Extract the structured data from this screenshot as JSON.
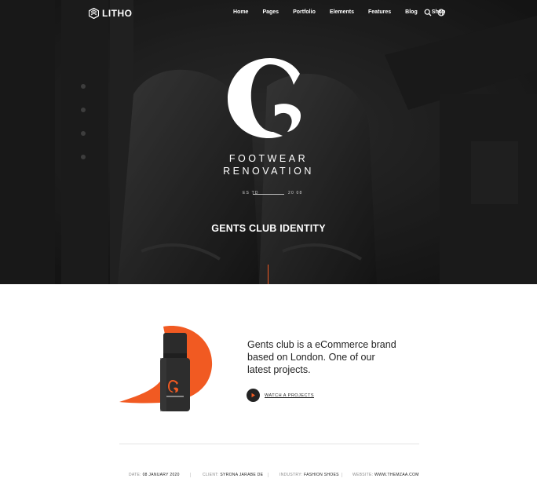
{
  "nav": {
    "logo_text": "LITHO",
    "items": [
      {
        "label": "Home"
      },
      {
        "label": "Pages"
      },
      {
        "label": "Portfolio"
      },
      {
        "label": "Elements"
      },
      {
        "label": "Features"
      },
      {
        "label": "Blog"
      },
      {
        "label": "Shop"
      }
    ],
    "icons": [
      "search-icon",
      "globe-icon"
    ]
  },
  "hero": {
    "brand_line1": "FOOTWEAR",
    "brand_line2": "RENOVATION",
    "estd_left": "ES TD",
    "estd_right": "20 08",
    "title": "GENTS CLUB IDENTITY"
  },
  "intro": {
    "text": "Gents club is a eCommerce brand based on London. One of our latest projects.",
    "watch_label": "WATCH A PROJECTS"
  },
  "meta": [
    {
      "label": "DATE:",
      "value": "08 JANUARY 2020"
    },
    {
      "label": "CLIENT:",
      "value": "SYRONA JARABE DE"
    },
    {
      "label": "INDUSTRY:",
      "value": "FASHION SHOES"
    },
    {
      "label": "WEBSITE:",
      "value": "WWW.THEMZAA.COM"
    }
  ],
  "colors": {
    "accent": "#f15a22",
    "hero_dark": "#2a2a2a",
    "text_dark": "#232323"
  }
}
